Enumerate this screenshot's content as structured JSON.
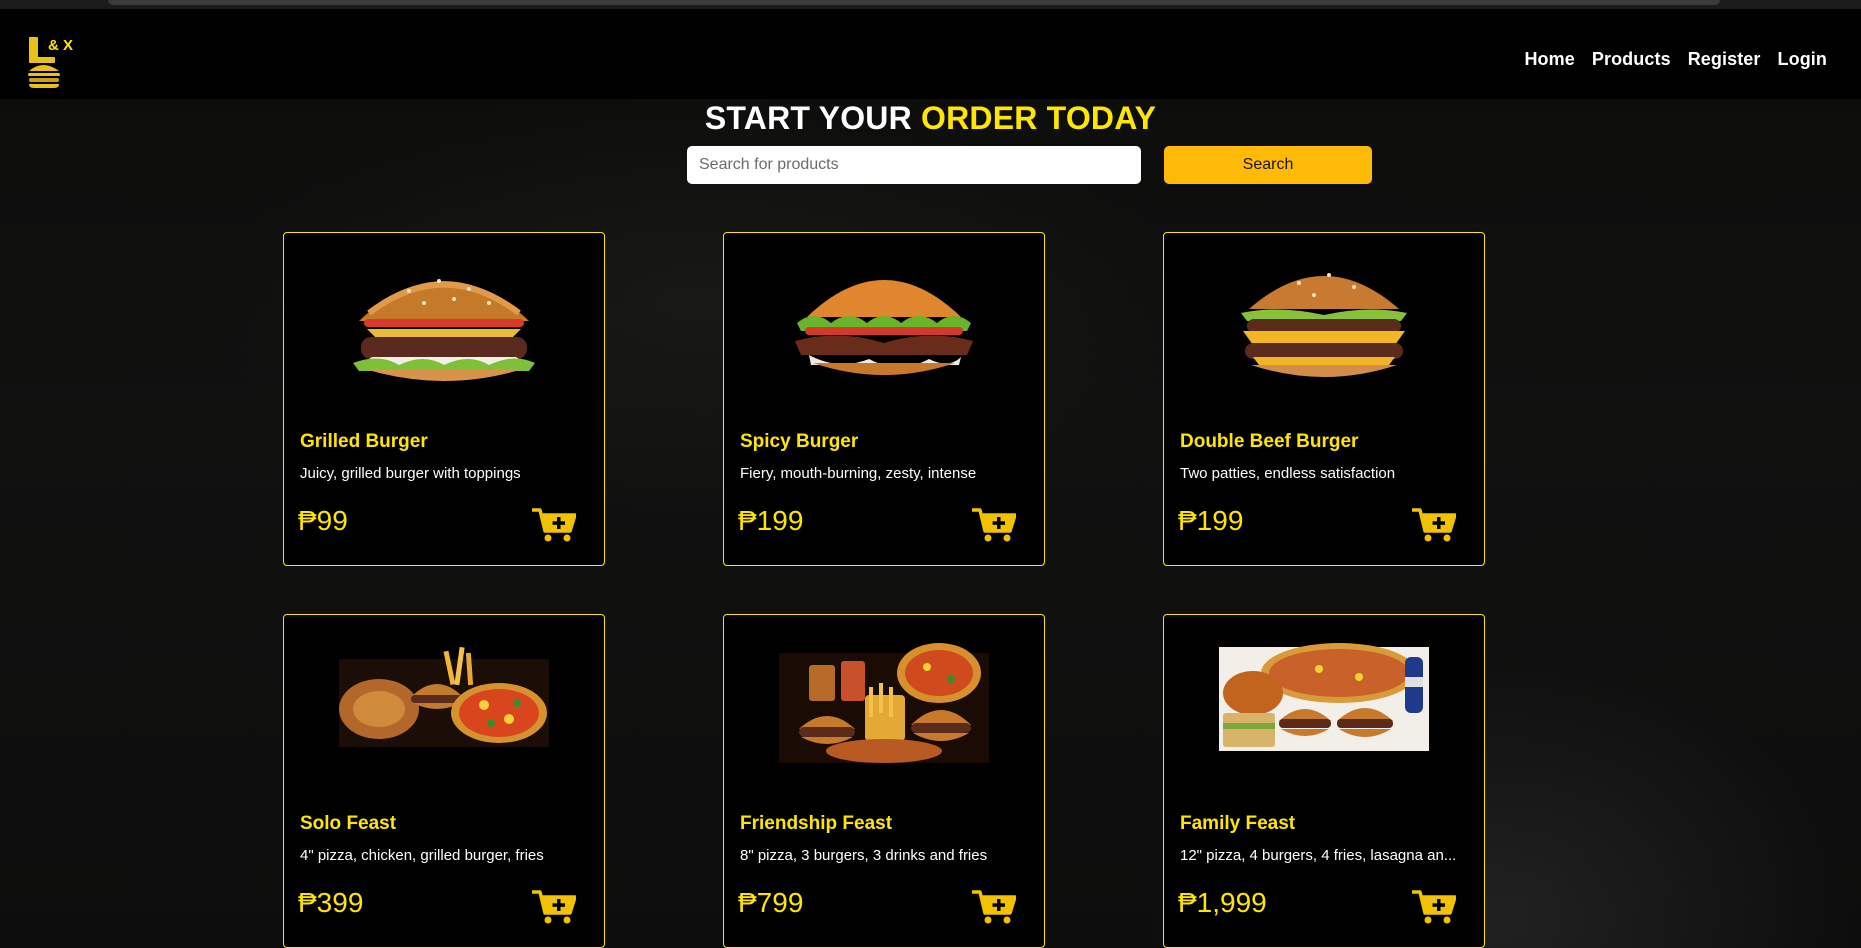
{
  "brand": {
    "logo_text": "& X",
    "accent_color": "#ffe600",
    "button_color": "#ffba08"
  },
  "nav": {
    "items": [
      {
        "label": "Home"
      },
      {
        "label": "Products"
      },
      {
        "label": "Register"
      },
      {
        "label": "Login"
      }
    ]
  },
  "hero": {
    "title_start": "START YOUR",
    "title_accent": "ORDER TODAY"
  },
  "search": {
    "placeholder": "Search for products",
    "value": "",
    "button_label": "Search"
  },
  "products": [
    {
      "name": "Grilled Burger",
      "description": "Juicy, grilled burger with toppings",
      "price": "₱99",
      "image": "grilled-burger-image",
      "cart_icon": "add-to-cart-icon"
    },
    {
      "name": "Spicy Burger",
      "description": "Fiery, mouth-burning, zesty, intense",
      "price": "₱199",
      "image": "spicy-burger-image",
      "cart_icon": "add-to-cart-icon"
    },
    {
      "name": "Double Beef Burger",
      "description": "Two patties, endless satisfaction",
      "price": "₱199",
      "image": "double-beef-burger-image",
      "cart_icon": "add-to-cart-icon"
    },
    {
      "name": "Solo Feast",
      "description": "4\" pizza, chicken, grilled burger, fries",
      "price": "₱399",
      "image": "solo-feast-image",
      "cart_icon": "add-to-cart-icon"
    },
    {
      "name": "Friendship Feast",
      "description": "8\" pizza, 3 burgers, 3 drinks and fries",
      "price": "₱799",
      "image": "friendship-feast-image",
      "cart_icon": "add-to-cart-icon"
    },
    {
      "name": "Family Feast",
      "description": "12\" pizza, 4 burgers, 4 fries, lasagna an...",
      "price": "₱1,999",
      "image": "family-feast-image",
      "cart_icon": "add-to-cart-icon"
    }
  ]
}
